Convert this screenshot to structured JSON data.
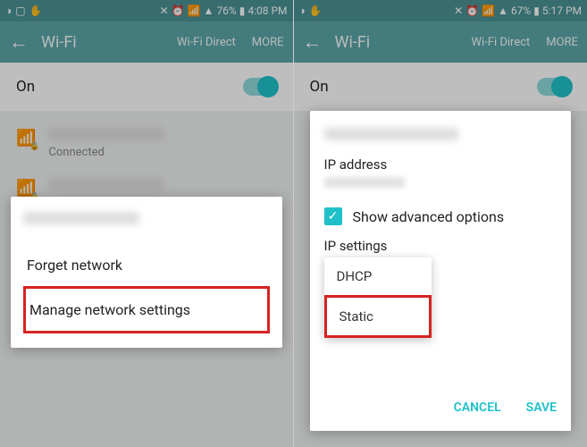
{
  "left": {
    "status": {
      "battery": "76%",
      "time": "4:08 PM"
    },
    "header": {
      "title": "Wi-Fi",
      "direct": "Wi-Fi Direct",
      "more": "MORE"
    },
    "on": "On",
    "net1_sub": "Connected",
    "dialog": {
      "forget": "Forget network",
      "manage": "Manage network settings"
    }
  },
  "right": {
    "status": {
      "battery": "67%",
      "time": "5:17 PM"
    },
    "header": {
      "title": "Wi-Fi",
      "direct": "Wi-Fi Direct",
      "more": "MORE"
    },
    "on": "On",
    "dialog": {
      "ip_label": "IP address",
      "show_adv": "Show advanced options",
      "ip_settings": "IP settings",
      "dhcp": "DHCP",
      "static": "Static",
      "cancel": "CANCEL",
      "save": "SAVE"
    }
  }
}
